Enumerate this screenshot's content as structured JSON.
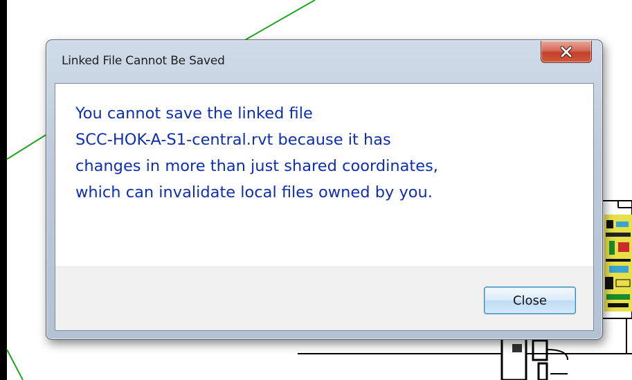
{
  "dialog": {
    "title": "Linked File Cannot Be Saved",
    "message_lines": [
      "You cannot save the linked file",
      "SCC-HOK-A-S1-central.rvt because it has",
      "changes in more than just shared coordinates,",
      "which can invalidate local files owned by you."
    ],
    "close_button_label": "Close"
  },
  "icons": {
    "title_close": "close-icon"
  },
  "colors": {
    "message_text": "#0d2fb0",
    "close_x_button": "#c1402a",
    "drawing_line": "#1ea51e"
  }
}
